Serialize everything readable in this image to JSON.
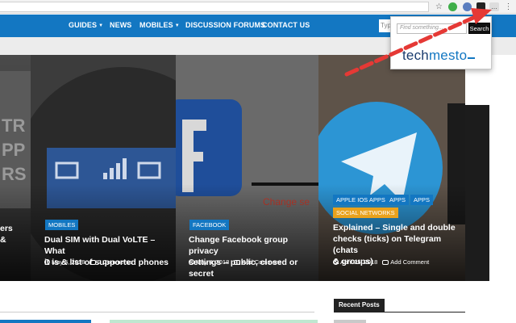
{
  "nav": {
    "items": [
      {
        "label": "GUIDES",
        "has_caret": true
      },
      {
        "label": "NEWS",
        "has_caret": false
      },
      {
        "label": "MOBILES",
        "has_caret": true
      },
      {
        "label": "DISCUSSION FORUMS",
        "has_caret": false
      },
      {
        "label": "CONTACT US",
        "has_caret": false
      }
    ],
    "search_placeholder": "Typ"
  },
  "hero": {
    "left_fragment_lines": [
      "ers",
      "&"
    ],
    "posts": [
      {
        "categories": [
          "MOBILES"
        ],
        "title_lines": [
          "Dual SIM with Dual VoLTE – What",
          "it is & list of supported phones"
        ],
        "date": "May 5, 2018",
        "comments": "2 Comments"
      },
      {
        "categories": [
          "FACEBOOK"
        ],
        "title_lines": [
          "Change Facebook group privacy",
          "settings – public, closed or secret"
        ],
        "date": "May 4, 2018",
        "comments": "Add Comment"
      },
      {
        "categories": [
          "APPLE IOS APPS",
          "APPS",
          "APPS",
          "SOCIAL NETWORKS"
        ],
        "title_lines": [
          "Explained – Single and double",
          "checks (ticks) on Telegram (chats",
          "& groups)"
        ],
        "date": "April 25, 2018",
        "comments": "Add Comment"
      }
    ]
  },
  "sidebar": {
    "recent_posts_label": "Recent Posts"
  },
  "popup": {
    "search_placeholder": "Find something...",
    "search_button": "Search",
    "logo_text_a": "tech",
    "logo_text_b": "mesto"
  },
  "colors": {
    "brand_blue": "#1377c2",
    "category_yellow": "#e9a21d",
    "annotation_red": "#e53935"
  },
  "icons": {
    "bookmark": "star-icon",
    "menu": "kebab-menu-icon"
  }
}
